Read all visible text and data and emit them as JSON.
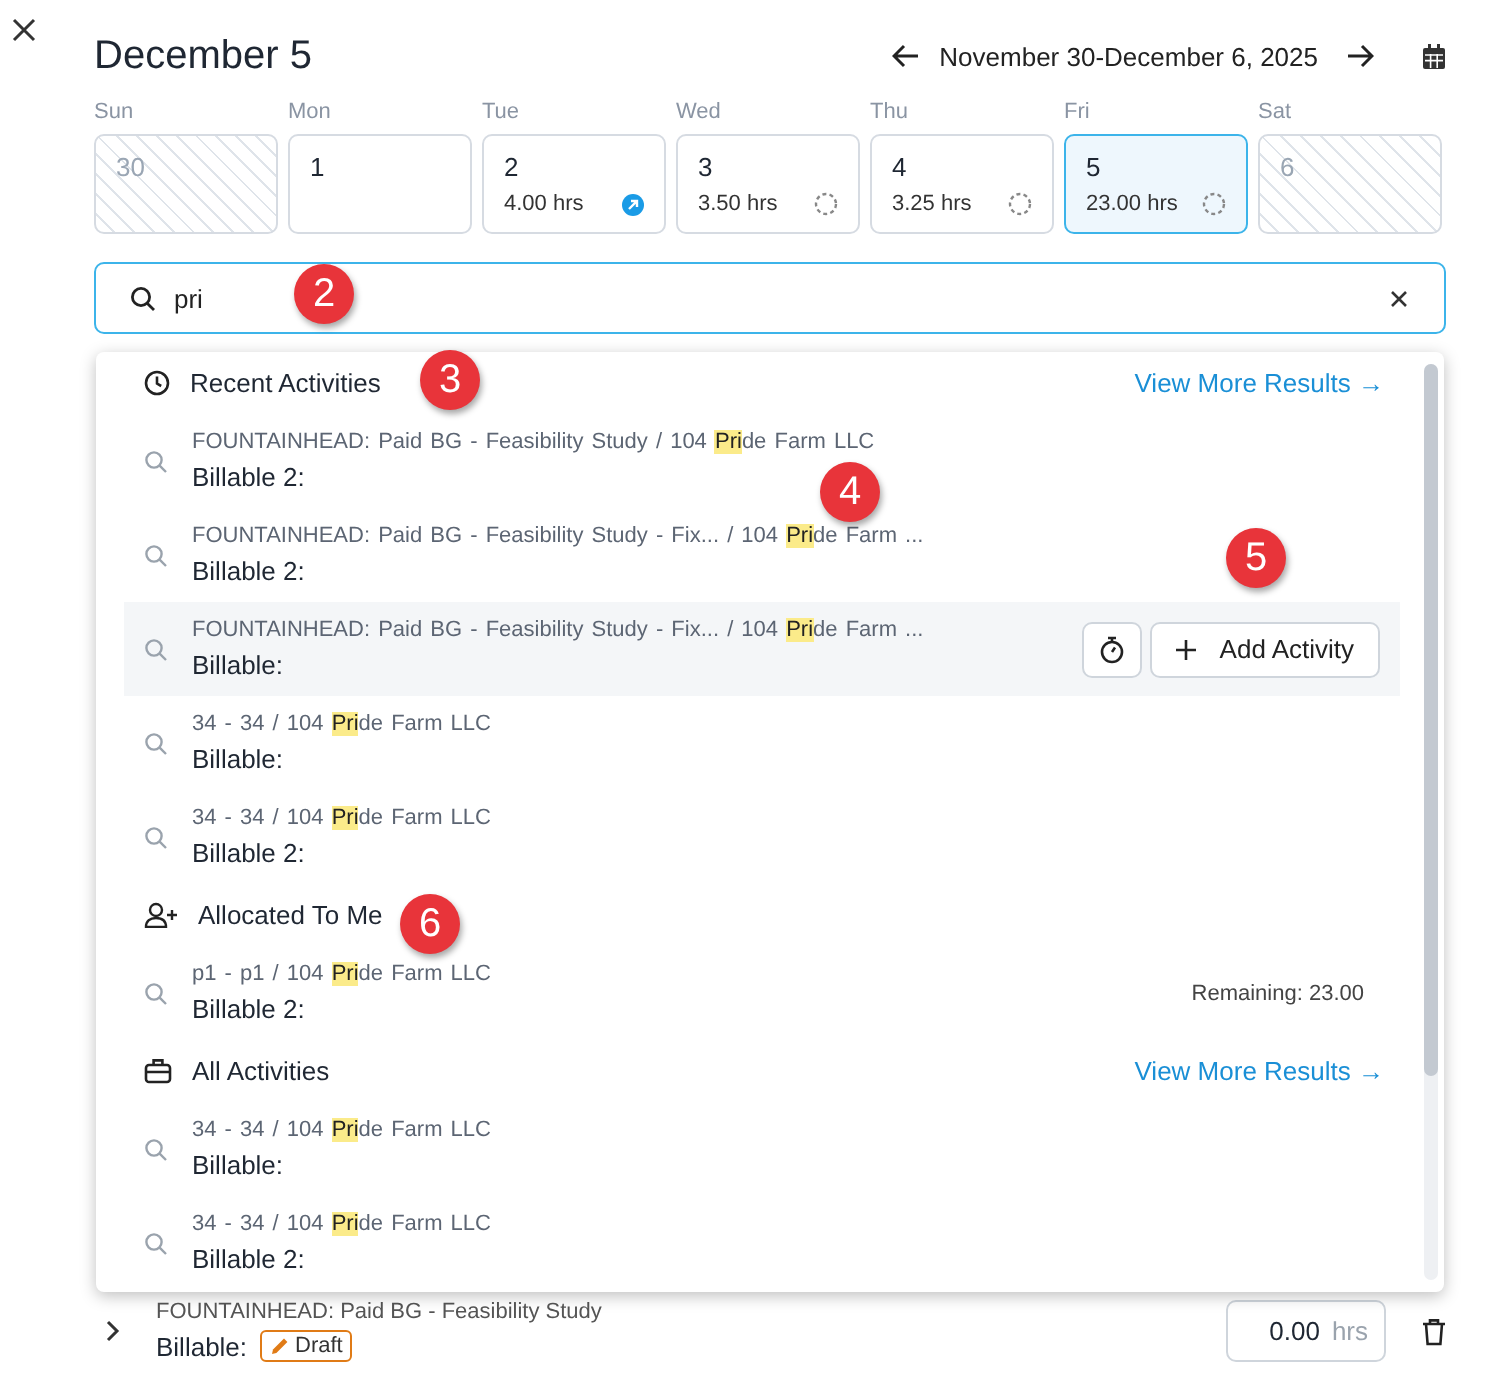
{
  "title": "December 5",
  "week_range": "November 30-December 6, 2025",
  "days": [
    {
      "weekday": "Sun",
      "date": "30",
      "disabled": true,
      "selected": false
    },
    {
      "weekday": "Mon",
      "date": "1",
      "disabled": false,
      "selected": false
    },
    {
      "weekday": "Tue",
      "date": "2",
      "hours": "4.00 hrs",
      "kind": "submitted",
      "disabled": false,
      "selected": false
    },
    {
      "weekday": "Wed",
      "date": "3",
      "hours": "3.50 hrs",
      "kind": "pending",
      "disabled": false,
      "selected": false
    },
    {
      "weekday": "Thu",
      "date": "4",
      "hours": "3.25 hrs",
      "kind": "pending",
      "disabled": false,
      "selected": false
    },
    {
      "weekday": "Fri",
      "date": "5",
      "hours": "23.00 hrs",
      "kind": "pending",
      "disabled": false,
      "selected": true
    },
    {
      "weekday": "Sat",
      "date": "6",
      "disabled": true,
      "selected": false
    }
  ],
  "search": {
    "value": "pri"
  },
  "sections": [
    {
      "title": "Recent Activities",
      "link": "View More Results →",
      "items": [
        {
          "path": "FOUNTAINHEAD: Paid BG - Feasibility Study / 104 ",
          "match": "Pri",
          "rest": "de Farm LLC",
          "label": "Billable 2:",
          "hovered": false
        },
        {
          "path": "FOUNTAINHEAD: Paid BG - Feasibility Study - Fix... / 104 ",
          "match": "Pri",
          "rest": "de Farm ...",
          "label": "Billable 2:",
          "hovered": false
        },
        {
          "path": "FOUNTAINHEAD: Paid BG - Feasibility Study - Fix... / 104 ",
          "match": "Pri",
          "rest": "de Farm ...",
          "label": "Billable:",
          "hovered": true,
          "action": "Add Activity"
        },
        {
          "path": "34 - 34 / 104 ",
          "match": "Pri",
          "rest": "de Farm LLC",
          "label": "Billable:",
          "hovered": false
        },
        {
          "path": "34 - 34 / 104 ",
          "match": "Pri",
          "rest": "de Farm LLC",
          "label": "Billable 2:",
          "hovered": false
        }
      ]
    },
    {
      "title": "Allocated To Me",
      "items": [
        {
          "path": "p1 - p1 / 104 ",
          "match": "Pri",
          "rest": "de Farm LLC",
          "label": "Billable 2:",
          "hovered": false,
          "remaining": "Remaining: 23.00"
        }
      ]
    },
    {
      "title": "All Activities",
      "link": "View More Results →",
      "items": [
        {
          "path": "34 - 34 / 104 ",
          "match": "Pri",
          "rest": "de Farm LLC",
          "label": "Billable:",
          "hovered": false
        },
        {
          "path": "34 - 34 / 104 ",
          "match": "Pri",
          "rest": "de Farm LLC",
          "label": "Billable 2:",
          "hovered": false
        }
      ]
    }
  ],
  "background_entry": {
    "path": "FOUNTAINHEAD: Paid BG - Feasibility Study",
    "label": "Billable:",
    "badge": "Draft",
    "hours": "0.00",
    "unit": "hrs"
  },
  "annotations": [
    "2",
    "3",
    "4",
    "5",
    "6"
  ]
}
